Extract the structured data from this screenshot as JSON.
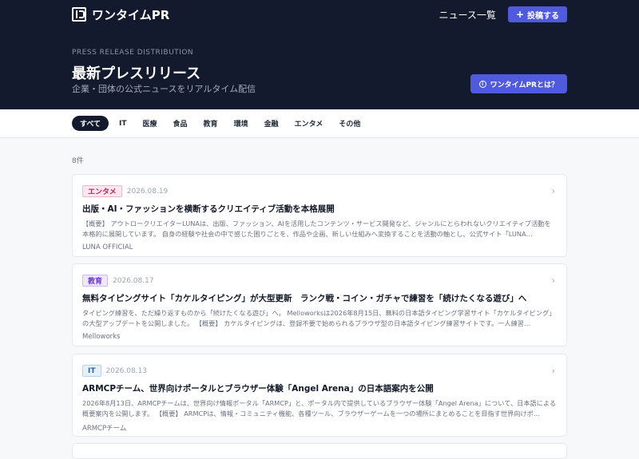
{
  "header": {
    "logo_text": "ワンタイムPR",
    "nav_news": "ニュース一覧",
    "post_label": "投稿する",
    "post_icon": "plus-icon"
  },
  "hero": {
    "eyebrow": "PRESS RELEASE DISTRIBUTION",
    "title": "最新プレスリリース",
    "subtitle": "企業・団体の公式ニュースをリアルタイム配信",
    "about_label": "ワンタイムPRとは？",
    "about_icon": "info-icon"
  },
  "categories": [
    {
      "label": "すべて",
      "active": true
    },
    {
      "label": "IT"
    },
    {
      "label": "医療"
    },
    {
      "label": "食品"
    },
    {
      "label": "教育"
    },
    {
      "label": "環境"
    },
    {
      "label": "金融"
    },
    {
      "label": "エンタメ"
    },
    {
      "label": "その他"
    }
  ],
  "count_label": "8件",
  "articles": [
    {
      "tag": "エンタメ",
      "tag_color": "#c0245c",
      "date": "2026.08.19",
      "title": "出版・AI・ファッションを横断するクリエイティブ活動を本格展開",
      "summary": "【概要】 アウトロークリエイターLUNAは、出版、ファッション、AIを活用したコンテンツ・サービス開発など、ジャンルにとらわれないクリエイティブ活動を本格的に展開しています。 自身の経験や社会の中で感じた困りごとを、作品や企画、新しい仕組みへ変換することを活動の軸とし、公式サイト「LUNA…",
      "source": "LUNA OFFICIAL"
    },
    {
      "tag": "教育",
      "tag_color": "#6b36c6",
      "date": "2026.08.17",
      "title": "無料タイピングサイト「カケルタイピング」が大型更新　ランク戦・コイン・ガチャで練習を「続けたくなる遊び」へ",
      "summary": "タイピング練習を、ただ繰り返すものから「続けたくなる遊び」へ。 Melloworksは2026年8月15日、無料の日本語タイピング学習サイト「カケルタイピング」の大型アップデートを公開しました。 【概要】 カケルタイピングは、登録不要で始められるブラウザ型の日本語タイピング練習サイトです。一人練習…",
      "source": "Melloworks"
    },
    {
      "tag": "IT",
      "tag_color": "#2563a8",
      "date": "2026.08.13",
      "title": "ARMCPチーム、世界向けポータルとブラウザー体験「Angel Arena」の日本語案内を公開",
      "summary": "2026年8月13日、ARMCPチームは、世界向け情報ポータル「ARMCP」と、ポータル内で提供しているブラウザー体験「Angel Arena」について、日本語による概要案内を公開します。 【概要】 ARMCPは、情報・コミュニティ機能、各種ツール、ブラウザーゲームを一つの場所にまとめることを目指す世界向けポ…",
      "source": "ARMCPチーム"
    }
  ]
}
